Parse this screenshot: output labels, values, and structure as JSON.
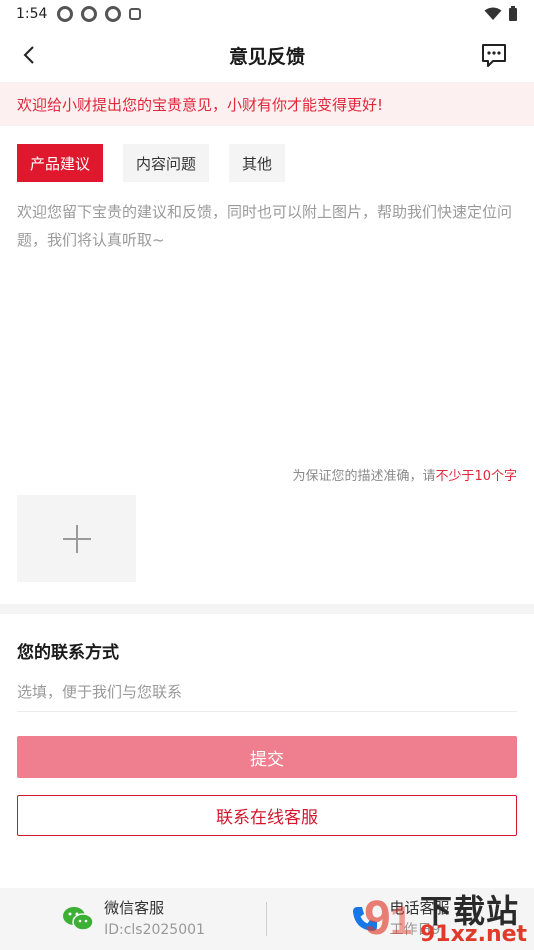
{
  "status_bar": {
    "time": "1:54",
    "icons": [
      "notification-icon",
      "notification-icon",
      "notification-icon",
      "text-a-icon",
      "wifi-icon",
      "battery-icon"
    ]
  },
  "nav": {
    "title": "意见反馈",
    "back_icon": "chevron-left-icon",
    "message_icon": "chat-bubble-icon"
  },
  "notice": "欢迎给小财提出您的宝贵意见，小财有你才能变得更好!",
  "tabs": [
    {
      "label": "产品建议",
      "active": true
    },
    {
      "label": "内容问题",
      "active": false
    },
    {
      "label": "其他",
      "active": false
    }
  ],
  "feedback": {
    "placeholder": "欢迎您留下宝贵的建议和反馈，同时也可以附上图片，帮助我们快速定位问题，我们将认真听取~"
  },
  "hint": {
    "prefix": "为保证您的描述准确，请",
    "emphasis": "不少于10个字"
  },
  "upload": {
    "icon": "plus-icon"
  },
  "contact": {
    "title": "您的联系方式",
    "placeholder": "选填，便于我们与您联系"
  },
  "buttons": {
    "submit": "提交",
    "online_service": "联系在线客服"
  },
  "bottom": {
    "wechat": {
      "label": "微信客服",
      "id": "ID:cls2025001",
      "icon": "wechat-icon"
    },
    "phone": {
      "label": "电话客服",
      "hours": "工作日9:",
      "icon": "phone-icon"
    }
  },
  "watermark": {
    "line1": "下载站",
    "line2": "91xz.net"
  },
  "colors": {
    "accent": "#e0182d",
    "submit_disabled": "#ef7f8e",
    "notice_bg": "#fdf0f1"
  }
}
